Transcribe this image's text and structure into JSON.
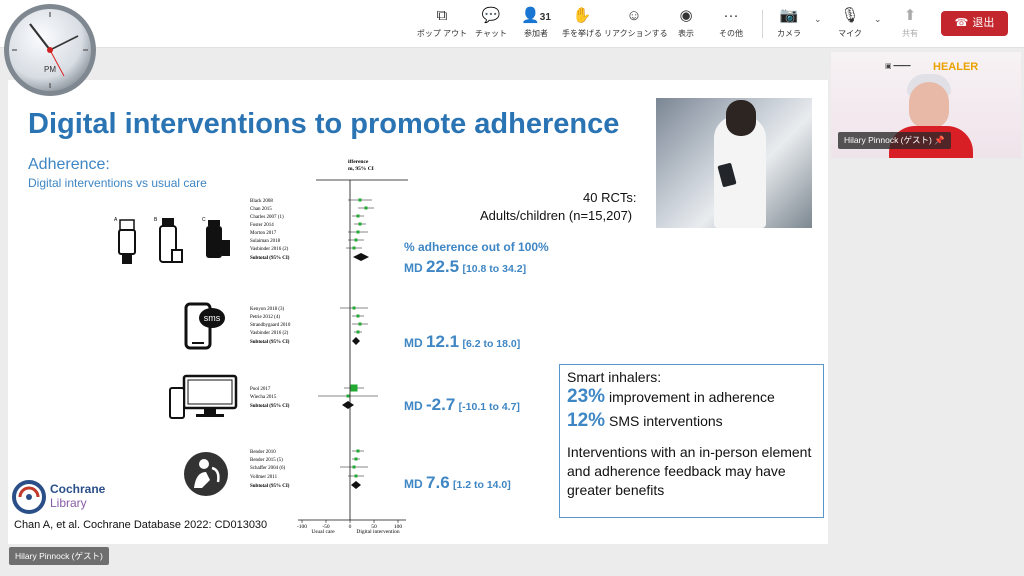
{
  "toolbar": {
    "popout": {
      "label": "ポップ アウト"
    },
    "chat": {
      "label": "チャット"
    },
    "participants": {
      "label": "参加者",
      "count": "31"
    },
    "raise_hand": {
      "label": "手を挙げる"
    },
    "reactions": {
      "label": "リアクションする"
    },
    "view": {
      "label": "表示"
    },
    "more": {
      "label": "その他"
    },
    "camera": {
      "label": "カメラ"
    },
    "mic": {
      "label": "マイク"
    },
    "share": {
      "label": "共有"
    },
    "leave": {
      "label": "退出"
    }
  },
  "clock": {
    "label": "PM"
  },
  "slide": {
    "title": "Digital interventions to promote adherence",
    "subtitle1": "Adherence:",
    "subtitle2": "Digital interventions vs usual care",
    "rct_line1": "40 RCTs:",
    "rct_line2": "Adults/children (n=15,207)",
    "pct_label": "% adherence out of 100%",
    "results": [
      {
        "prefix": "MD",
        "value": "22.5",
        "ci": "[10.8 to 34.2]"
      },
      {
        "prefix": "MD",
        "value": "12.1",
        "ci": "[6.2 to 18.0]"
      },
      {
        "prefix": "MD",
        "value": "-2.7",
        "ci": "[-10.1 to 4.7]"
      },
      {
        "prefix": "MD",
        "value": "7.6",
        "ci": "[1.2 to 14.0]"
      }
    ],
    "box": {
      "heading": "Smart inhalers:",
      "row1_pct": "23%",
      "row1_text": "improvement in adherence",
      "row2_pct": "12%",
      "row2_text": "SMS interventions",
      "para": "Interventions with an in-person element and adherence feedback may have greater benefits"
    },
    "cochrane": {
      "line1": "Cochrane",
      "line2": "Library"
    },
    "citation": "Chan  A, et al. Cochrane Database 2022: CD013030",
    "sms_icon_text": "sms",
    "forest": {
      "header1": "ifference",
      "header2": "m, 95% CI",
      "axis_ticks": [
        "-100",
        "-50",
        "0",
        "50",
        "100"
      ],
      "axis_left": "Usual care",
      "axis_right": "Digital intervention",
      "studies": [
        "Black 2008",
        "Chan 2015",
        "Charles 2007 (1)",
        "Foster 2014",
        "Morton 2017",
        "Sulaiman 2018",
        "Vasbinder 2016 (2)",
        "Subtotal (95% CI)",
        "Kenyon 2018 (3)",
        "Petrie 2012 (4)",
        "Strandbygaard 2010",
        "Vasbinder 2016 (2)",
        "Subtotal (95% CI)",
        "Pool 2017",
        "Wiecha 2015",
        "Subtotal (95% CI)",
        "Bender 2010",
        "Bender 2015 (5)",
        "Schaffer 2004 (6)",
        "Vollmer 2011",
        "Subtotal (95% CI)"
      ]
    }
  },
  "video": {
    "name": "Hilary Pinnock (ゲスト)",
    "logo": "HEALER"
  },
  "bottom_name": "Hilary Pinnock (ゲスト)",
  "colors": {
    "accent_blue": "#3e86c4",
    "leave_red": "#c4262e",
    "marker_green": "#22aa33"
  }
}
